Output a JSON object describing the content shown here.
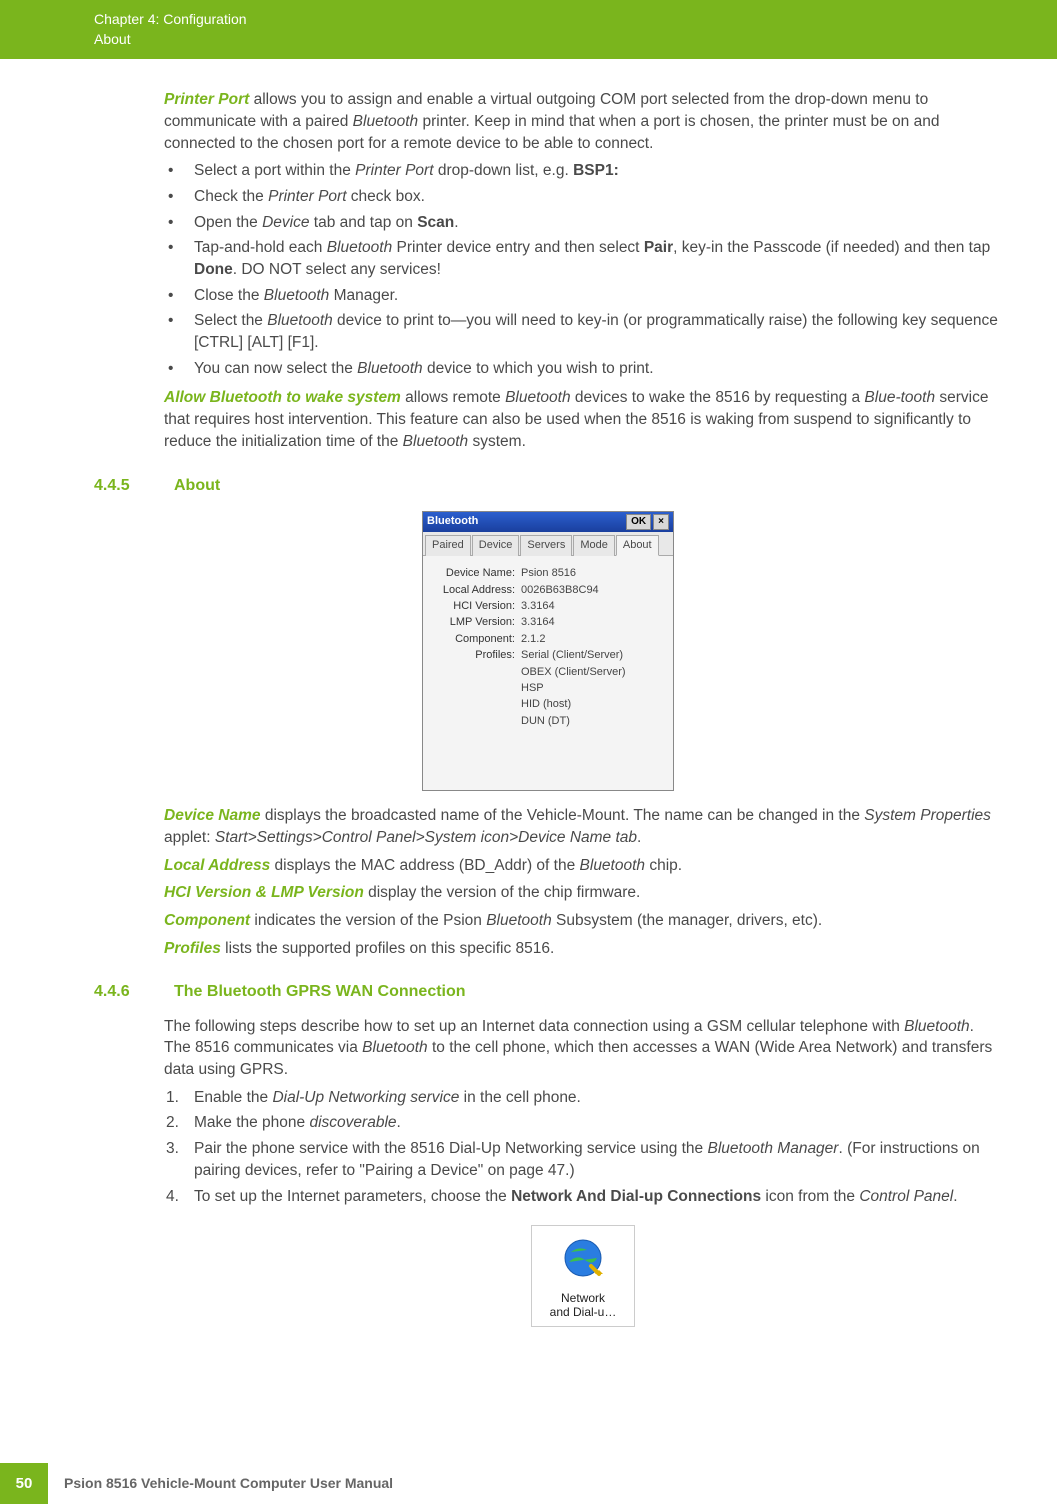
{
  "header": {
    "chapter": "Chapter 4:  Configuration",
    "section": "About"
  },
  "sec_printer": {
    "term": "Printer Port",
    "intro_rest": " allows you to assign and enable a virtual outgoing COM port selected from the drop-down menu to communicate with a paired ",
    "intro_it1": "Bluetooth",
    "intro_rest2": " printer. Keep in mind that when a port is chosen, the printer must be on and connected to the chosen port for a remote device to be able to connect.",
    "b1a": "Select a port within the ",
    "b1i": "Printer Port",
    "b1b": " drop-down list, e.g. ",
    "b1bold": "BSP1:",
    "b2a": "Check the ",
    "b2i": "Printer Port",
    "b2b": " check box.",
    "b3a": "Open the ",
    "b3i": "Device",
    "b3b": " tab and tap on ",
    "b3bold": "Scan",
    "b3c": ".",
    "b4a": "Tap-and-hold each ",
    "b4i": "Bluetooth",
    "b4b": " Printer device entry and then select ",
    "b4bold1": "Pair",
    "b4c": ", key-in the Passcode (if needed) and then tap ",
    "b4bold2": "Done",
    "b4d": ". DO NOT select any services!",
    "b5a": "Close the ",
    "b5i": "Bluetooth",
    "b5b": " Manager.",
    "b6a": "Select the ",
    "b6i": "Bluetooth",
    "b6b": " device to print to—you will need to key-in (or programmatically raise) the following key sequence [CTRL] [ALT] [F1].",
    "b7a": "You can now select the ",
    "b7i": "Bluetooth",
    "b7b": " device to which you wish to print.",
    "allow_term": "Allow Bluetooth to wake system",
    "allow_a": " allows remote ",
    "allow_i1": "Bluetooth",
    "allow_b": " devices to wake the 8516 by requesting a ",
    "allow_i2": "Blue-tooth",
    "allow_c": " service that requires host intervention. This feature can also be used when the 8516 is waking from suspend to significantly to reduce the initialization time of the ",
    "allow_i3": "Bluetooth",
    "allow_d": " system."
  },
  "sec_about": {
    "num": "4.4.5",
    "title": "About",
    "win_title": "Bluetooth",
    "ok": "OK",
    "close": "×",
    "tabs": {
      "paired": "Paired",
      "device": "Device",
      "servers": "Servers",
      "mode": "Mode",
      "about": "About"
    },
    "rows": {
      "dn_l": "Device Name:",
      "dn_v": "Psion 8516",
      "la_l": "Local Address:",
      "la_v": "0026B63B8C94",
      "hci_l": "HCI Version:",
      "hci_v": "3.3164",
      "lmp_l": "LMP Version:",
      "lmp_v": "3.3164",
      "cmp_l": "Component:",
      "cmp_v": "2.1.2",
      "prof_l": "Profiles:",
      "prof1": "Serial (Client/Server)",
      "prof2": "OBEX (Client/Server)",
      "prof3": "HSP",
      "prof4": "HID (host)",
      "prof5": "DUN (DT)"
    },
    "dn_term": "Device Name",
    "dn_a": " displays the broadcasted name of the Vehicle-Mount. The name can be changed in the ",
    "dn_i1": "System Properties",
    "dn_b": " applet: ",
    "dn_i2": "Start>Settings>Control Panel>System icon>Device Name tab",
    "dn_c": ".",
    "la_term": "Local Address",
    "la_a": " displays the MAC address (BD_Addr) of the ",
    "la_i": "Bluetooth",
    "la_b": " chip.",
    "ver_term": "HCI Version & LMP Version",
    "ver_a": " display the version of the chip firmware.",
    "cmp_term": "Component",
    "cmp_a": " indicates the version of the Psion ",
    "cmp_i": "Bluetooth",
    "cmp_b": " Subsystem (the manager, drivers, etc).",
    "prof_term": "Profiles",
    "prof_a": " lists the supported profiles on this specific 8516."
  },
  "sec_gprs": {
    "num": "4.4.6",
    "title": "The Bluetooth GPRS WAN Connection",
    "intro_a": "The following steps describe how to set up an Internet data connection using a GSM cellular telephone with ",
    "intro_i1": "Bluetooth",
    "intro_b": ". The 8516 communicates via ",
    "intro_i2": "Bluetooth",
    "intro_c": " to the cell phone, which then accesses a WAN (Wide Area Network) and transfers data using GPRS.",
    "s1a": "Enable the ",
    "s1i": "Dial-Up Networking service",
    "s1b": " in the cell phone.",
    "s2a": "Make the phone ",
    "s2i": "discoverable",
    "s2b": ".",
    "s3a": "Pair the phone service with the 8516 Dial-Up Networking service using the ",
    "s3i": "Bluetooth Manager",
    "s3b": ". (For instructions on pairing devices, refer to \"Pairing a Device\" on page 47.)",
    "s4a": "To set up the Internet parameters, choose the ",
    "s4bold": "Network And Dial-up Connections",
    "s4b": " icon from the ",
    "s4i": "Control Panel",
    "s4c": ".",
    "icon_l1": "Network",
    "icon_l2": "and Dial-u…"
  },
  "footer": {
    "page": "50",
    "title": "Psion 8516 Vehicle-Mount Computer User Manual"
  }
}
